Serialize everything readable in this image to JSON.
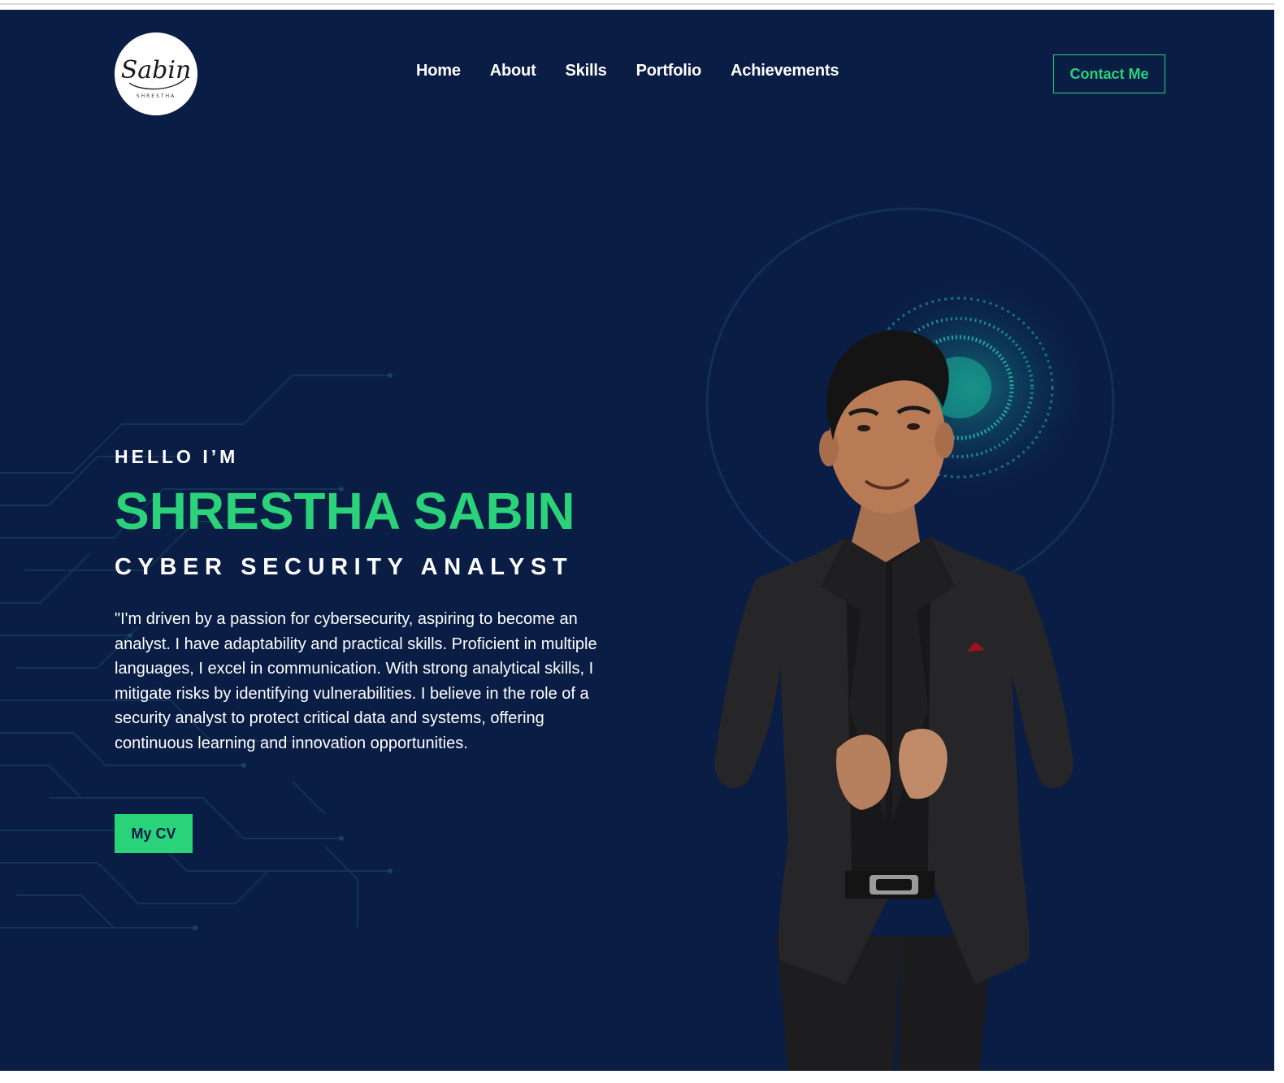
{
  "header": {
    "logo_text": "Sabin",
    "logo_subtext": "SHRESTHA",
    "nav": [
      {
        "label": "Home"
      },
      {
        "label": "About"
      },
      {
        "label": "Skills"
      },
      {
        "label": "Portfolio"
      },
      {
        "label": "Achievements"
      }
    ],
    "contact_label": "Contact Me"
  },
  "hero": {
    "greeting": "HELLO I’M",
    "name": "SHRESTHA SABIN",
    "role": "CYBER SECURITY ANALYST",
    "bio": "\"I'm driven by a passion for cybersecurity, aspiring to become an analyst. I have adaptability and practical skills. Proficient in multiple languages, I excel in communication. With strong analytical skills, I mitigate risks by identifying vulnerabilities. I believe in the role of a security analyst to protect critical data and systems, offering continuous learning and innovation opportunities.",
    "cv_label": "My CV"
  },
  "colors": {
    "background": "#0a1d45",
    "accent": "#2ad27a",
    "text": "#ffffff"
  }
}
